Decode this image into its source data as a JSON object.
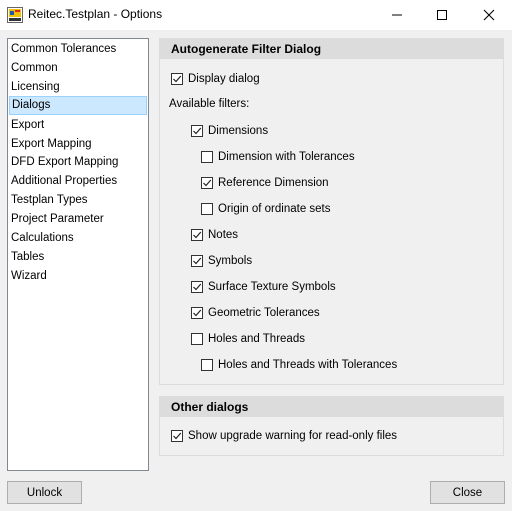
{
  "window": {
    "title": "Reitec.Testplan - Options",
    "app_icon": "testplan-app-icon",
    "controls": [
      "minimize-icon",
      "maximize-icon",
      "close-icon"
    ]
  },
  "sidebar": {
    "selected_index": 3,
    "items": [
      {
        "label": "Common Tolerances"
      },
      {
        "label": "Common"
      },
      {
        "label": "Licensing"
      },
      {
        "label": "Dialogs"
      },
      {
        "label": "Export"
      },
      {
        "label": "Export Mapping"
      },
      {
        "label": "DFD Export Mapping"
      },
      {
        "label": "Additional Properties"
      },
      {
        "label": "Testplan Types"
      },
      {
        "label": "Project Parameter"
      },
      {
        "label": "Calculations"
      },
      {
        "label": "Tables"
      },
      {
        "label": "Wizard"
      }
    ]
  },
  "filter_panel": {
    "title": "Autogenerate Filter Dialog",
    "display_dialog": {
      "label": "Display dialog",
      "checked": true
    },
    "available_filters_label": "Available filters:",
    "filters": [
      {
        "label": "Dimensions",
        "checked": true,
        "level": 1
      },
      {
        "label": "Dimension with Tolerances",
        "checked": false,
        "level": 2
      },
      {
        "label": "Reference Dimension",
        "checked": true,
        "level": 2
      },
      {
        "label": "Origin of ordinate sets",
        "checked": false,
        "level": 2
      },
      {
        "label": "Notes",
        "checked": true,
        "level": 1
      },
      {
        "label": "Symbols",
        "checked": true,
        "level": 1
      },
      {
        "label": "Surface Texture Symbols",
        "checked": true,
        "level": 1
      },
      {
        "label": "Geometric Tolerances",
        "checked": true,
        "level": 1
      },
      {
        "label": "Holes and Threads",
        "checked": false,
        "level": 1
      },
      {
        "label": "Holes and Threads with Tolerances",
        "checked": false,
        "level": 2
      }
    ]
  },
  "other_panel": {
    "title": "Other dialogs",
    "upgrade_warning": {
      "label": "Show upgrade warning for read-only files",
      "checked": true
    }
  },
  "buttons": {
    "unlock": "Unlock",
    "close": "Close"
  },
  "colors": {
    "selection_bg": "#cce8ff",
    "panel_header_bg": "#dcdcdc",
    "window_bg": "#f0f0f0"
  }
}
